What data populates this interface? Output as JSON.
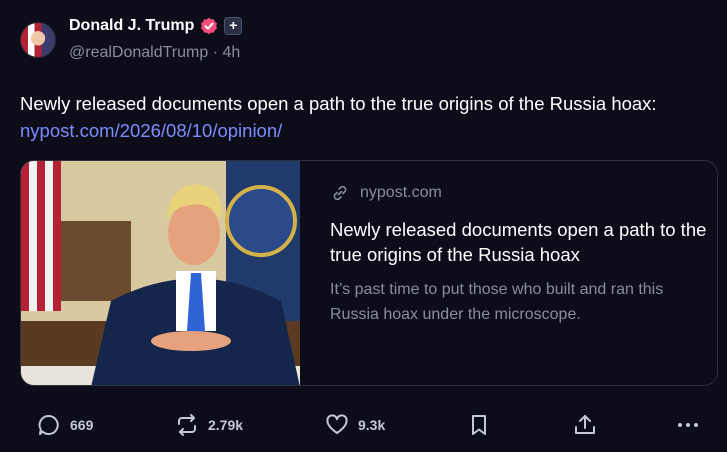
{
  "author": {
    "name": "Donald J. Trump",
    "handle": "@realDonaldTrump",
    "separator": "·",
    "time": "4h",
    "plus_badge": "+",
    "verified_color": "#f24d7a"
  },
  "post": {
    "text": "Newly released documents open a path to the true origins of the Russia hoax: ",
    "link": "nypost.com/2026/08/10/opinion/"
  },
  "card": {
    "domain": "nypost.com",
    "title": "Newly released documents open a path to the true origins of the Russia hoax",
    "description": "It’s past time to put those who built and ran this Russia hoax under the microscope."
  },
  "actions": {
    "replies": "669",
    "reposts": "2.79k",
    "likes": "9.3k"
  },
  "colors": {
    "background": "#0d0d1a",
    "link": "#7b8cff",
    "muted": "#8b8d98"
  }
}
